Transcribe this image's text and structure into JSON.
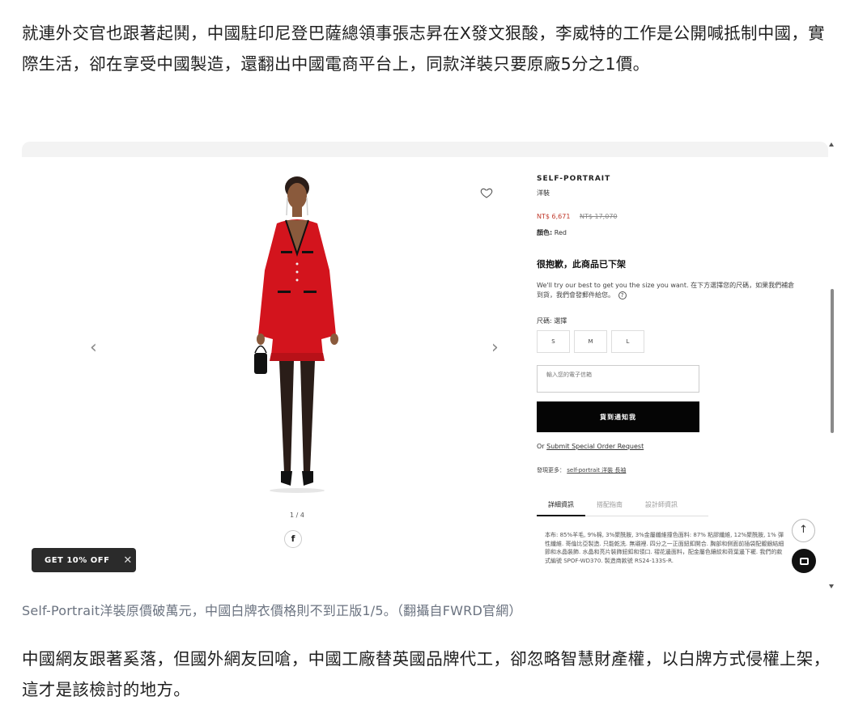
{
  "article": {
    "paragraph1": "就連外交官也跟著起鬨，中國駐印尼登巴薩總領事張志昇在X發文狠酸，李威特的工作是公開喊抵制中國，實際生活，卻在享受中國製造，還翻出中國電商平台上，同款洋裝只要原廠5分之1價。",
    "caption": "Self-Portrait洋裝原價破萬元，中國白牌衣價格則不到正版1/5。（翻攝自FWRD官網）",
    "paragraph2": "中國網友跟著奚落，但國外網友回嗆，中國工廠替英國品牌代工，卻忽略智慧財產權，以白牌方式侵權上架，這才是該檢討的地方。"
  },
  "product": {
    "brand": "SELF-PORTRAIT",
    "type": "洋裝",
    "price": "NT$ 6,671",
    "original_price": "NT$ 17,070",
    "color_label": "顏色:",
    "color_value": "Red",
    "soldout_title": "很抱歉，此商品已下架",
    "notice": "We'll try our best to get you the size you want. 在下方選擇您的尺碼，如果我們補倉到貨，我們會發郵件給您。",
    "help_icon": "?",
    "size_label": "尺碼: 選擇",
    "sizes": [
      "S",
      "M",
      "L"
    ],
    "email_placeholder": "輸入您的電子信箱",
    "notify_button": "貨到通知我",
    "special_prefix": "Or",
    "special_link": "Submit Special Order Request",
    "discover_prefix": "發現更多：",
    "discover_links": "self-portrait 洋裝 長袖",
    "tabs": [
      "詳細資訊",
      "搭配指南",
      "設計師資訊"
    ],
    "description": "本布: 85%羊毛, 9%棉, 3%聚酰胺, 3%金屬纖維撞色面料: 87% 粘膠纖維, 12%聚酰胺, 1% 彈性纖維. 哥倫比亞製造. 只能乾洗. 無襯裡. 四分之一正面鈕釦開合. 胸部和側面前插袋配鍍銀結細節和水晶裝飾. 水晶和亮片裝飾鈕釦和領口. 褶花邊面料，配金屬色鑲紋和荷葉邊下襬. 我們的款式編號 SPOF-WD370. 製造商款號 RS24-133S-R."
  },
  "gallery": {
    "counter": "1 / 4",
    "prev_icon": "chevron-left-icon",
    "next_icon": "chevron-right-icon",
    "share_icon": "facebook-icon",
    "share_glyph": "f"
  },
  "promo": {
    "label": "GET 10% OFF",
    "close": "✕"
  },
  "colors": {
    "dress": "#d3141d",
    "price": "#c0392b",
    "button": "#050505"
  }
}
